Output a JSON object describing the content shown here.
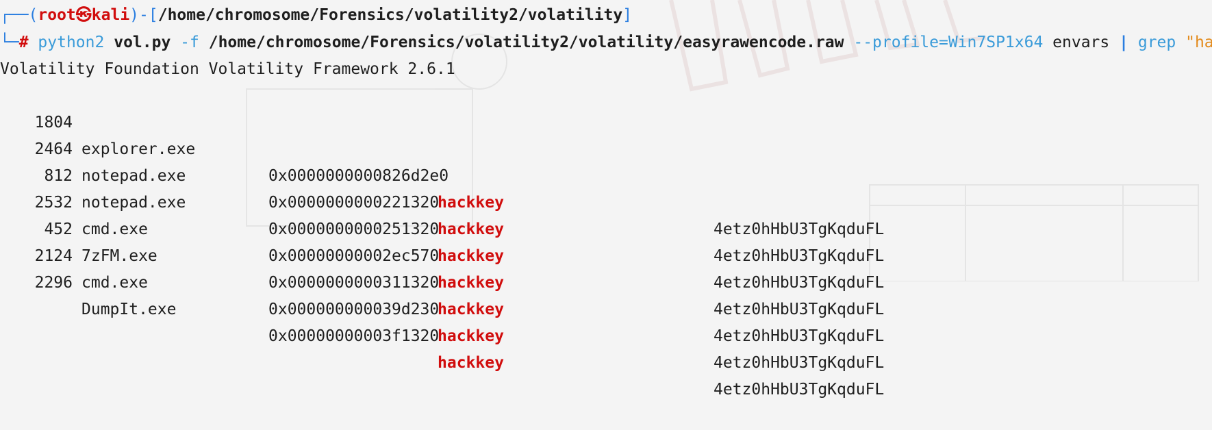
{
  "prompt": {
    "corner_top": "┌──(",
    "user": "root",
    "skull": "㉿",
    "host": "kali",
    "sep": ")-[",
    "path": "/home/chromosome/Forensics/volatility2/volatility",
    "close": "]",
    "corner_bottom": "└─",
    "hash": "#"
  },
  "command": {
    "interpreter": "python2",
    "script": "vol.py",
    "flag_f": "-f",
    "file": "/home/chromosome/Forensics/volatility2/volatility/easyrawencode.raw",
    "profile": "--profile=Win7SP1x64",
    "plugin": "envars",
    "pipe": "|",
    "grep": "grep",
    "pattern": "\"hackkey\""
  },
  "banner": "Volatility Foundation Volatility Framework 2.6.1",
  "rows": [
    {
      "pid": "1804",
      "process": "explorer.exe",
      "block": "0x0000000000826d2e0",
      "variable": "hackkey",
      "value": "4etz0hHbU3TgKqduFL"
    },
    {
      "pid": "2464",
      "process": "notepad.exe",
      "block": "0x0000000000221320",
      "variable": "hackkey",
      "value": "4etz0hHbU3TgKqduFL"
    },
    {
      "pid": "812",
      "process": "notepad.exe",
      "block": "0x0000000000251320",
      "variable": "hackkey",
      "value": "4etz0hHbU3TgKqduFL"
    },
    {
      "pid": "2532",
      "process": "cmd.exe",
      "block": "0x00000000002ec570",
      "variable": "hackkey",
      "value": "4etz0hHbU3TgKqduFL"
    },
    {
      "pid": "452",
      "process": "7zFM.exe",
      "block": "0x0000000000311320",
      "variable": "hackkey",
      "value": "4etz0hHbU3TgKqduFL"
    },
    {
      "pid": "2124",
      "process": "cmd.exe",
      "block": "0x000000000039d230",
      "variable": "hackkey",
      "value": "4etz0hHbU3TgKqduFL"
    },
    {
      "pid": "2296",
      "process": "DumpIt.exe",
      "block": "0x00000000003f1320",
      "variable": "hackkey",
      "value": "4etz0hHbU3TgKqduFL"
    }
  ]
}
